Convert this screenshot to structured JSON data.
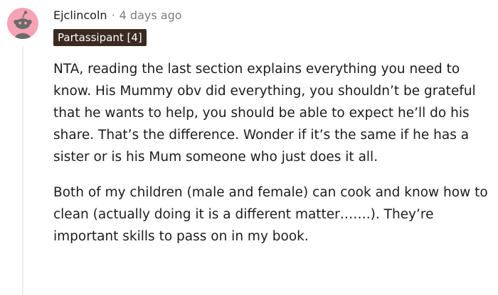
{
  "comment": {
    "username": "Ejclincoln",
    "separator": "·",
    "timestamp": "4 days ago",
    "flair": "Partassipant [4]",
    "avatar_icon": "snoo-avatar-icon",
    "avatar_color": "#f7a3b5",
    "paragraphs": [
      "NTA, reading the last section explains everything you need to know. His Mummy obv did everything, you shouldn’t be grateful that he wants to help, you should be able to expect he’ll do his share. That’s the difference. Wonder if it’s the same if he has a sister or is his Mum someone who just does it all.",
      "Both of my children (male and female) can cook and know how to clean (actually doing it is a different matter…….). They’re important skills to pass on in my book."
    ]
  }
}
